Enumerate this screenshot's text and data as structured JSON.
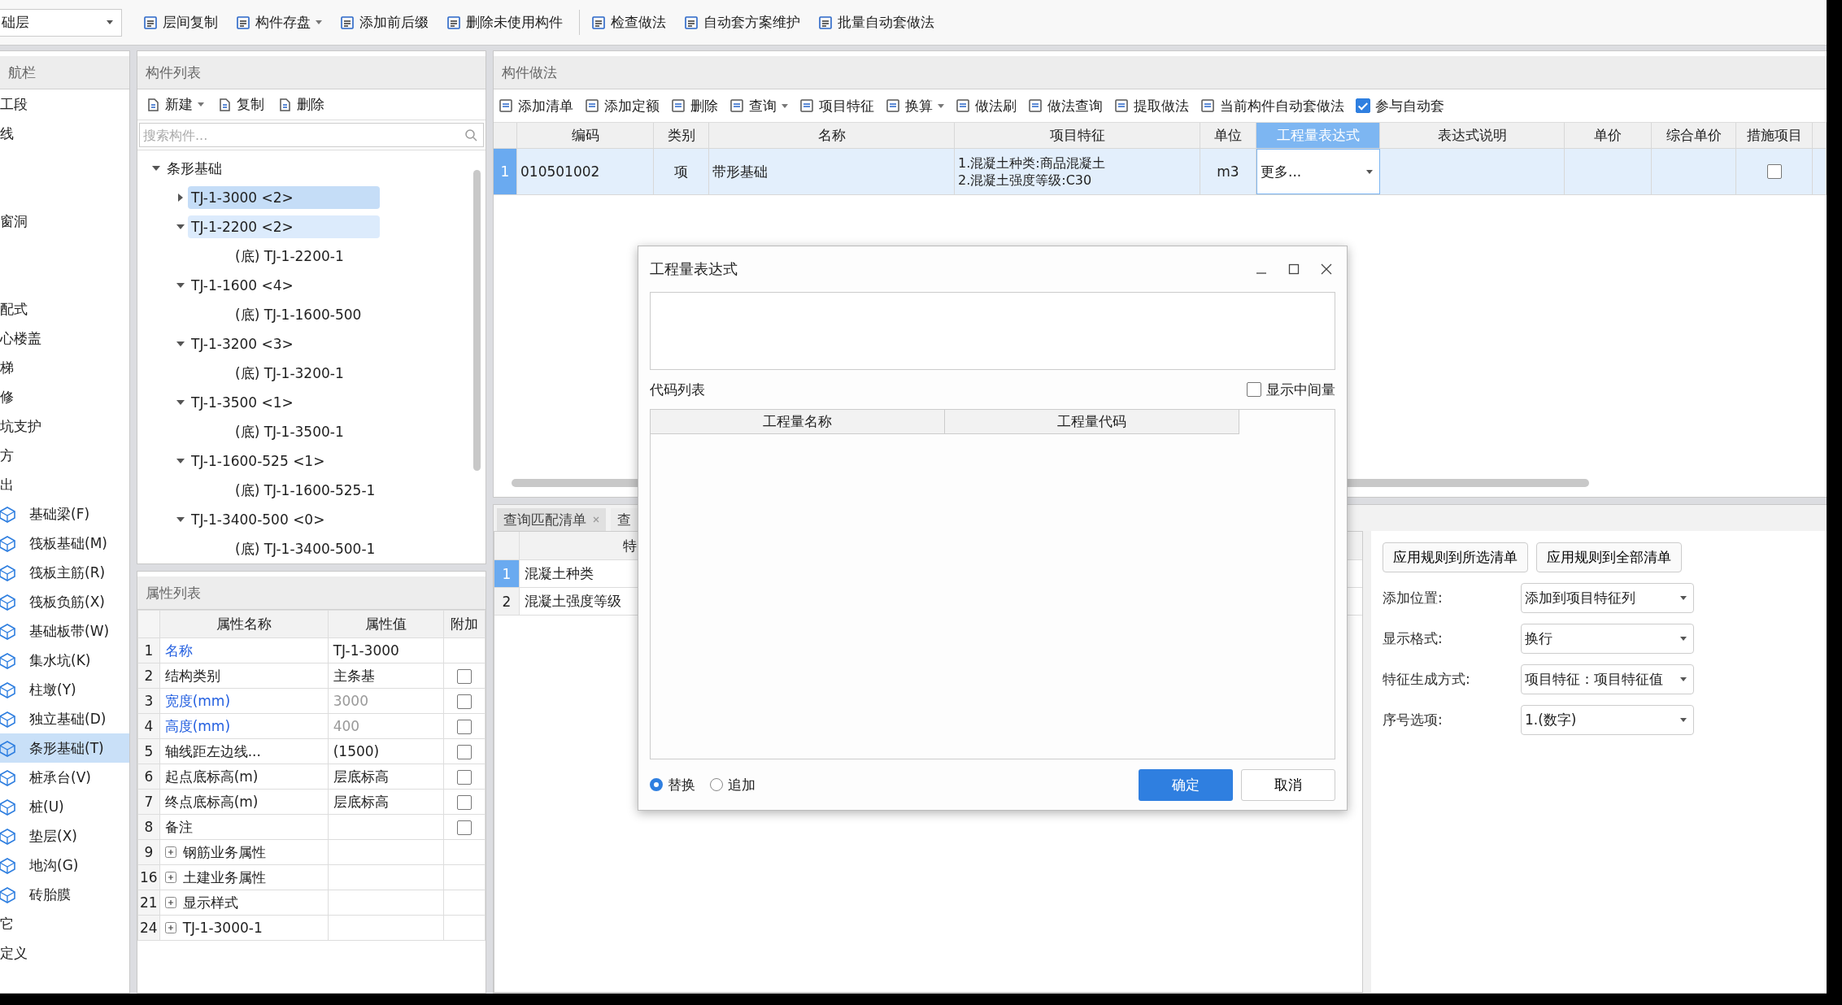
{
  "toolbar": {
    "floor_select": "础层",
    "buttons": [
      {
        "label": "层间复制",
        "dropdown": false,
        "separator_before": false
      },
      {
        "label": "构件存盘",
        "dropdown": true,
        "separator_before": false
      },
      {
        "label": "添加前后缀",
        "dropdown": false,
        "separator_before": false
      },
      {
        "label": "删除未使用构件",
        "dropdown": false,
        "separator_before": false
      },
      {
        "label": "检查做法",
        "dropdown": false,
        "separator_before": true
      },
      {
        "label": "自动套方案维护",
        "dropdown": false,
        "separator_before": false
      },
      {
        "label": "批量自动套做法",
        "dropdown": false,
        "separator_before": false
      }
    ]
  },
  "nav": {
    "title": "航栏",
    "items": [
      {
        "kind": "category",
        "label": "工段"
      },
      {
        "kind": "category",
        "label": "线"
      },
      {
        "kind": "blank"
      },
      {
        "kind": "blank"
      },
      {
        "kind": "category",
        "label": "窗洞"
      },
      {
        "kind": "blank"
      },
      {
        "kind": "blank"
      },
      {
        "kind": "category",
        "label": "配式"
      },
      {
        "kind": "category",
        "label": "心楼盖"
      },
      {
        "kind": "category",
        "label": "梯"
      },
      {
        "kind": "category",
        "label": "修"
      },
      {
        "kind": "category",
        "label": "坑支护"
      },
      {
        "kind": "category",
        "label": "方"
      },
      {
        "kind": "category",
        "label": "出"
      },
      {
        "kind": "component",
        "label": "基础梁(F)",
        "selected": false
      },
      {
        "kind": "component",
        "label": "筏板基础(M)",
        "selected": false
      },
      {
        "kind": "component",
        "label": "筏板主筋(R)",
        "selected": false
      },
      {
        "kind": "component",
        "label": "筏板负筋(X)",
        "selected": false
      },
      {
        "kind": "component",
        "label": "基础板带(W)",
        "selected": false
      },
      {
        "kind": "component",
        "label": "集水坑(K)",
        "selected": false
      },
      {
        "kind": "component",
        "label": "柱墩(Y)",
        "selected": false
      },
      {
        "kind": "component",
        "label": "独立基础(D)",
        "selected": false
      },
      {
        "kind": "component",
        "label": "条形基础(T)",
        "selected": true
      },
      {
        "kind": "component",
        "label": "桩承台(V)",
        "selected": false
      },
      {
        "kind": "component",
        "label": "桩(U)",
        "selected": false
      },
      {
        "kind": "component",
        "label": "垫层(X)",
        "selected": false
      },
      {
        "kind": "component",
        "label": "地沟(G)",
        "selected": false
      },
      {
        "kind": "component",
        "label": "砖胎膜",
        "selected": false
      },
      {
        "kind": "category",
        "label": "它"
      },
      {
        "kind": "category",
        "label": "定义"
      }
    ]
  },
  "component_list": {
    "title": "构件列表",
    "actions": [
      {
        "label": "新建",
        "dropdown": true
      },
      {
        "label": "复制",
        "dropdown": false
      },
      {
        "label": "删除",
        "dropdown": false
      }
    ],
    "search": {
      "placeholder": "搜索构件..."
    },
    "tree": [
      {
        "label": "条形基础",
        "expanded": true,
        "selected": false,
        "highlighted": false,
        "children": [
          {
            "label": "TJ-1-3000 <2>",
            "expanded": false,
            "selected": true,
            "highlighted": false
          },
          {
            "label": "TJ-1-2200 <2>",
            "expanded": true,
            "selected": false,
            "highlighted": true,
            "children": [
              {
                "label": "(底) TJ-1-2200-1",
                "selected": false,
                "highlighted": false
              }
            ]
          },
          {
            "label": "TJ-1-1600 <4>",
            "expanded": true,
            "selected": false,
            "highlighted": false,
            "children": [
              {
                "label": "(底) TJ-1-1600-500",
                "selected": false,
                "highlighted": false
              }
            ]
          },
          {
            "label": "TJ-1-3200 <3>",
            "expanded": true,
            "selected": false,
            "highlighted": false,
            "children": [
              {
                "label": "(底) TJ-1-3200-1",
                "selected": false,
                "highlighted": false
              }
            ]
          },
          {
            "label": "TJ-1-3500 <1>",
            "expanded": true,
            "selected": false,
            "highlighted": false,
            "children": [
              {
                "label": "(底) TJ-1-3500-1",
                "selected": false,
                "highlighted": false
              }
            ]
          },
          {
            "label": "TJ-1-1600-525 <1>",
            "expanded": true,
            "selected": false,
            "highlighted": false,
            "children": [
              {
                "label": "(底) TJ-1-1600-525-1",
                "selected": false,
                "highlighted": false
              }
            ]
          },
          {
            "label": "TJ-1-3400-500 <0>",
            "expanded": true,
            "selected": false,
            "highlighted": false,
            "children": [
              {
                "label": "(底) TJ-1-3400-500-1",
                "selected": false,
                "highlighted": false
              }
            ]
          }
        ]
      }
    ]
  },
  "properties": {
    "title": "属性列表",
    "columns": [
      "属性名称",
      "属性值",
      "附加"
    ],
    "rows": [
      {
        "index": "1",
        "name": "名称",
        "value": "TJ-1-3000",
        "public": true,
        "dimmed": false
      },
      {
        "index": "2",
        "name": "结构类别",
        "value": "主条基",
        "public": false,
        "dimmed": false,
        "extra": false
      },
      {
        "index": "3",
        "name": "宽度(mm)",
        "value": "3000",
        "public": true,
        "dimmed": true,
        "extra": false
      },
      {
        "index": "4",
        "name": "高度(mm)",
        "value": "400",
        "public": true,
        "dimmed": true,
        "extra": false
      },
      {
        "index": "5",
        "name": "轴线距左边线...",
        "value": "(1500)",
        "public": false,
        "dimmed": false,
        "extra": false
      },
      {
        "index": "6",
        "name": "起点底标高(m)",
        "value": "层底标高",
        "public": false,
        "dimmed": false,
        "extra": false
      },
      {
        "index": "7",
        "name": "终点底标高(m)",
        "value": "层底标高",
        "public": false,
        "dimmed": false,
        "extra": false
      },
      {
        "index": "8",
        "name": "备注",
        "public": false,
        "extra": false
      },
      {
        "index": "9",
        "name": "钢筋业务属性",
        "public": false,
        "expandable": true
      },
      {
        "index": "16",
        "name": "土建业务属性",
        "public": false,
        "expandable": true
      },
      {
        "index": "21",
        "name": "显示样式",
        "public": false,
        "expandable": true
      },
      {
        "index": "24",
        "name": "TJ-1-3000-1",
        "public": false,
        "expandable": true
      }
    ]
  },
  "methods": {
    "title": "构件做法",
    "tools": [
      {
        "label": "添加清单",
        "dropdown": false
      },
      {
        "label": "添加定额",
        "dropdown": false
      },
      {
        "label": "删除",
        "dropdown": false
      },
      {
        "label": "查询",
        "dropdown": true
      },
      {
        "label": "项目特征",
        "dropdown": false
      },
      {
        "label": "换算",
        "dropdown": true
      },
      {
        "label": "做法刷",
        "dropdown": false
      },
      {
        "label": "做法查询",
        "dropdown": false
      },
      {
        "label": "提取做法",
        "dropdown": false
      },
      {
        "label": "当前构件自动套做法",
        "dropdown": false
      }
    ],
    "auto_apply": {
      "label": "参与自动套",
      "checked": true
    },
    "columns": [
      {
        "label": "编码",
        "selected": false
      },
      {
        "label": "类别",
        "selected": false
      },
      {
        "label": "名称",
        "selected": false
      },
      {
        "label": "项目特征",
        "selected": false
      },
      {
        "label": "单位",
        "selected": false
      },
      {
        "label": "工程量表达式",
        "selected": true
      },
      {
        "label": "表达式说明",
        "selected": false
      },
      {
        "label": "单价",
        "selected": false
      },
      {
        "label": "综合单价",
        "selected": false
      },
      {
        "label": "措施项目",
        "selected": false
      }
    ],
    "rows": [
      {
        "index": "1",
        "selected": true,
        "code": "010501002",
        "type": "项",
        "name": "带形基础",
        "features": [
          "1.混凝土种类:商品混凝土",
          "2.混凝土强度等级:C30"
        ],
        "unit": "m3",
        "expression": "更多...",
        "measure": false
      }
    ]
  },
  "lower": {
    "tabs": [
      {
        "label": "查询匹配清单",
        "closable": true,
        "selected": true
      },
      {
        "label": "查",
        "closable": false,
        "selected": false
      }
    ],
    "column": "特",
    "rows": [
      {
        "index": "1",
        "text": "混凝土种类",
        "selected": true
      },
      {
        "index": "2",
        "text": "混凝土强度等级",
        "selected": false
      }
    ],
    "rules": {
      "buttons": [
        "应用规则到所选清单",
        "应用规则到全部清单"
      ],
      "fields": [
        {
          "label": "添加位置:",
          "value": "添加到项目特征列"
        },
        {
          "label": "显示格式:",
          "value": "换行"
        },
        {
          "label": "特征生成方式:",
          "value": "项目特征：项目特征值"
        },
        {
          "label": "序号选项:",
          "value": "1.(数字)"
        }
      ]
    }
  },
  "dialog": {
    "title": "工程量表达式",
    "code_list": "代码列表",
    "show_intermediate": {
      "label": "显示中间量",
      "checked": false
    },
    "columns": [
      "工程量名称",
      "工程量代码"
    ],
    "modes": [
      {
        "label": "替换",
        "selected": true
      },
      {
        "label": "追加",
        "selected": false
      }
    ],
    "ok": "确定",
    "cancel": "取消"
  }
}
